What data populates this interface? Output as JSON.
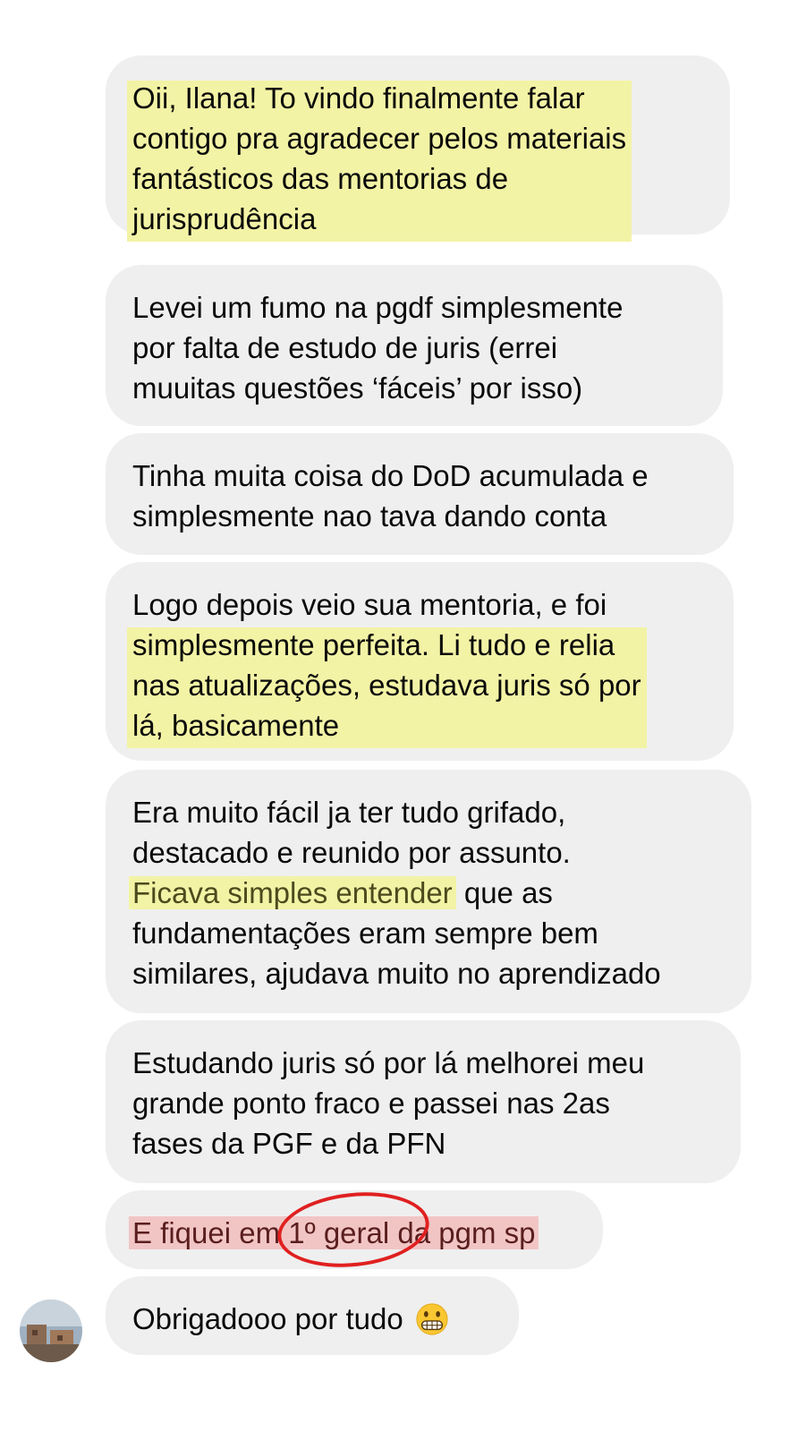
{
  "messages": [
    {
      "lines": [
        "Oii, Ilana! To vindo finalmente falar",
        "contigo pra agradecer pelos materiais",
        "fantásticos das mentorias de",
        "jurisprudência"
      ]
    },
    {
      "lines": [
        "Levei um fumo na pgdf simplesmente",
        "por falta de estudo de juris (errei",
        "muuitas questões ‘fáceis’ por isso)"
      ]
    },
    {
      "lines": [
        "Tinha muita coisa do DoD acumulada e",
        "simplesmente nao tava dando conta"
      ]
    },
    {
      "lines": [
        "Logo depois veio sua mentoria, e foi",
        "simplesmente perfeita. Li tudo e relia",
        "nas atualizações, estudava juris só por",
        "lá, basicamente"
      ]
    },
    {
      "lines": [
        "Era muito fácil ja ter tudo grifado,",
        "destacado e reunido por assunto.",
        "Ficava simples entender",
        " que as",
        "fundamentações eram sempre bem",
        "similares, ajudava muito no aprendizado"
      ]
    },
    {
      "lines": [
        "Estudando juris só por lá melhorei meu",
        "grande ponto fraco e passei nas 2as",
        "fases da PGF e da PFN"
      ]
    },
    {
      "lines": [
        "E fiquei em 1º geral da pgm sp"
      ]
    },
    {
      "lines": [
        "Obrigadooo por tudo"
      ],
      "emoji": "grimacing-face"
    }
  ],
  "colors": {
    "bubble": "#efefef",
    "highlight_yellow": "#f3f3a6",
    "highlight_red": "#f2c5c5",
    "circle_annotation": "#e02020"
  }
}
